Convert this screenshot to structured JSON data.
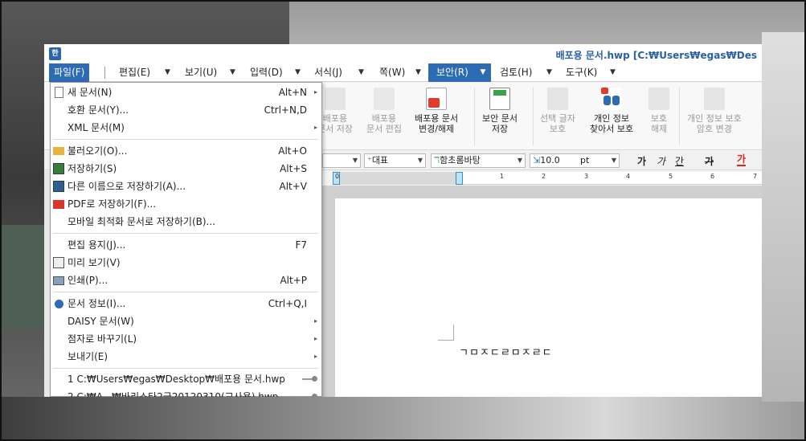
{
  "window": {
    "title": "배포용 문서.hwp [C:₩Users₩egas₩Des"
  },
  "menubar": {
    "items": [
      {
        "label": "파일(F)"
      },
      {
        "label": "편집(E)"
      },
      {
        "label": "보기(U)"
      },
      {
        "label": "입력(D)"
      },
      {
        "label": "서식(J)"
      },
      {
        "label": "쪽(W)"
      },
      {
        "label": "보안(R)"
      },
      {
        "label": "검토(H)"
      },
      {
        "label": "도구(K)"
      }
    ]
  },
  "ribbon": {
    "buttons": [
      {
        "line1": "배포용",
        "line2": "문서 저장"
      },
      {
        "line1": "배포용",
        "line2": "문서 편집"
      },
      {
        "line1": "배포용 문서",
        "line2": "변경/해제"
      },
      {
        "line1": "보안 문서",
        "line2": "저장"
      },
      {
        "line1": "선택 글자",
        "line2": "보호"
      },
      {
        "line1": "개인 정보",
        "line2": "찾아서 보호"
      },
      {
        "line1": "보호",
        "line2": "해제"
      },
      {
        "line1": "개인 정보 보호",
        "line2": "암호 변경"
      }
    ]
  },
  "format_bar": {
    "style": "대표",
    "font": "함초롬바탕",
    "size": "10.0",
    "unit": "pt",
    "bold": "가",
    "italic": "가",
    "underline": "간",
    "strike": "가",
    "color": "가"
  },
  "ruler": {
    "numbers": [
      "0",
      "1",
      "2",
      "3",
      "4",
      "5",
      "6",
      "7"
    ]
  },
  "document": {
    "text": "ㄱㅁㅈㄷㄹㅁㅈㄹㄷ"
  },
  "file_menu": {
    "items": [
      {
        "label": "새 문서(N)",
        "shortcut": "Alt+N",
        "submenu": true,
        "icon": "new-doc-icon"
      },
      {
        "label": "호환 문서(Y)...",
        "shortcut": "Ctrl+N,D",
        "submenu": false,
        "icon": ""
      },
      {
        "label": "XML 문서(M)",
        "shortcut": "",
        "submenu": true,
        "icon": ""
      },
      {
        "label": "불러오기(O)...",
        "shortcut": "Alt+O",
        "submenu": false,
        "icon": "open-folder-icon"
      },
      {
        "label": "저장하기(S)",
        "shortcut": "Alt+S",
        "submenu": false,
        "icon": "save-icon"
      },
      {
        "label": "다른 이름으로 저장하기(A)...",
        "shortcut": "Alt+V",
        "submenu": false,
        "icon": "save-as-icon"
      },
      {
        "label": "PDF로 저장하기(F)...",
        "shortcut": "",
        "submenu": false,
        "icon": "pdf-icon"
      },
      {
        "label": "모바일 최적화 문서로 저장하기(B)...",
        "shortcut": "",
        "submenu": false,
        "icon": ""
      },
      {
        "label": "편집 용지(J)...",
        "shortcut": "F7",
        "submenu": false,
        "icon": ""
      },
      {
        "label": "미리 보기(V)",
        "shortcut": "",
        "submenu": false,
        "icon": "preview-icon"
      },
      {
        "label": "인쇄(P)...",
        "shortcut": "Alt+P",
        "submenu": false,
        "icon": "print-icon"
      },
      {
        "label": "문서 정보(I)...",
        "shortcut": "Ctrl+Q,I",
        "submenu": false,
        "icon": "info-icon"
      },
      {
        "label": "DAISY 문서(W)",
        "shortcut": "",
        "submenu": true,
        "icon": ""
      },
      {
        "label": "점자로 바꾸기(L)",
        "shortcut": "",
        "submenu": true,
        "icon": ""
      },
      {
        "label": "보내기(E)",
        "shortcut": "",
        "submenu": true,
        "icon": ""
      }
    ],
    "recent": [
      {
        "label": "1 C:₩Users₩egas₩Desktop₩배포용 문서.hwp"
      },
      {
        "label": "2 C:₩A...₩바리스타2급20120310(교사용).hwp"
      }
    ]
  },
  "colors": {
    "accent": "#2d6bb5",
    "title": "#2a5fa5"
  }
}
